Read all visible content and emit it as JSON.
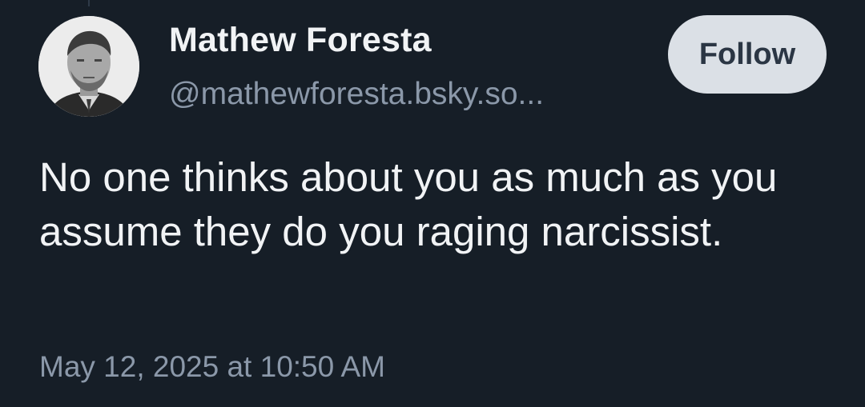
{
  "post": {
    "author": {
      "display_name": "Mathew Foresta",
      "handle": "@mathewforesta.bsky.so..."
    },
    "follow_label": "Follow",
    "text": "No one thinks about you as much as you assume they do you raging narcissist.",
    "timestamp": "May 12, 2025 at 10:50 AM"
  },
  "colors": {
    "background": "#161e27",
    "primary_text": "#f1f3f5",
    "secondary_text": "#8b98a9",
    "follow_button_bg": "#dbe0e6",
    "follow_button_text": "#2b3644"
  }
}
